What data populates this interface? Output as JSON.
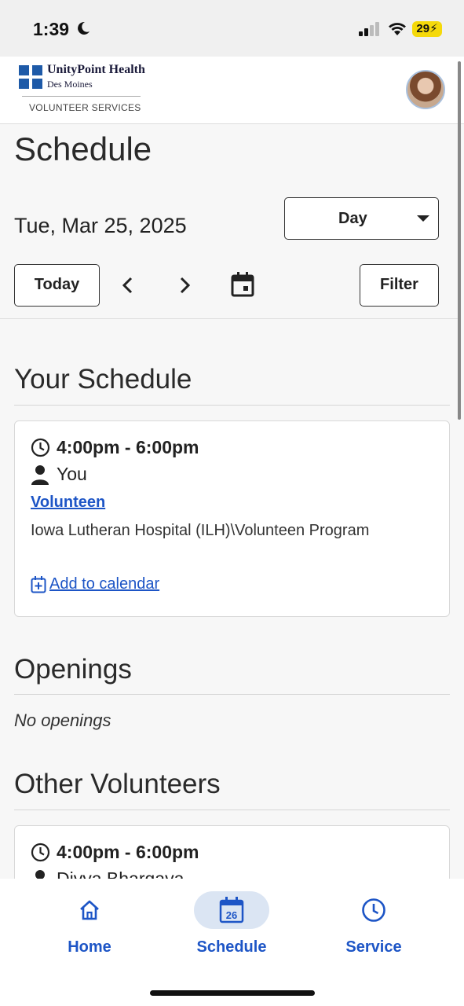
{
  "status": {
    "time": "1:39",
    "battery": "29"
  },
  "header": {
    "org_name": "UnityPoint Health",
    "org_location": "Des Moines",
    "org_department": "VOLUNTEER SERVICES"
  },
  "page": {
    "title": "Schedule"
  },
  "toolbar": {
    "date": "Tue, Mar 25, 2025",
    "view_value": "Day",
    "today_label": "Today",
    "filter_label": "Filter"
  },
  "your_schedule": {
    "heading": "Your Schedule",
    "shift": {
      "time": "4:00pm - 6:00pm",
      "person": "You",
      "role": "Volunteen",
      "location": "Iowa Lutheran Hospital (ILH)\\Volunteen Program",
      "add_to_calendar": "Add to calendar"
    }
  },
  "openings": {
    "heading": "Openings",
    "empty_text": "No openings"
  },
  "other_volunteers": {
    "heading": "Other Volunteers",
    "shift": {
      "time": "4:00pm - 6:00pm",
      "person": "Divya Bhargava"
    }
  },
  "bottom_nav": {
    "items": [
      {
        "label": "Home",
        "icon": "home-icon"
      },
      {
        "label": "Schedule",
        "icon": "calendar-icon",
        "badge": "26",
        "active": true
      },
      {
        "label": "Service",
        "icon": "clock-icon"
      }
    ]
  },
  "colors": {
    "accent": "#1d55c6",
    "active_pill": "#dbe5f3",
    "brand": "#1e5aa8",
    "battery": "#f5d90a"
  }
}
